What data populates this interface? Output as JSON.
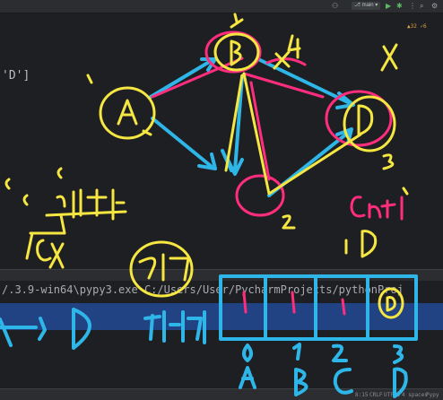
{
  "toolbar": {
    "user_icon": "user-icon",
    "branch": "main",
    "run_icon": "run-icon",
    "debug_icon": "debug-icon",
    "more_icon": "more-icon",
    "search_icon": "search-icon",
    "settings_icon": "gear-icon"
  },
  "editor": {
    "code_fragment": "'D']",
    "inspection_counts": "▲32  ✓6"
  },
  "terminal": {
    "command": "/.3.9-win64\\pypy3.exe C:/Users/User/PycharmProjects/pythonProj",
    "output": "1D"
  },
  "statusbar": {
    "position": "8:15",
    "line_sep": "CRLF",
    "encoding": "UTF-8",
    "indent": "4 spaces",
    "interpreter": "Pypy 3.9"
  },
  "annotations": {
    "nodes": [
      "A",
      "B",
      "C",
      "D"
    ],
    "edge_weights": [
      "1",
      "2",
      "3"
    ],
    "count_label": "cnt 1",
    "count_value": "1 D",
    "topo_label": "위상정렬",
    "path_label": "경로",
    "path_question": "A → D",
    "how_many": "몇가지",
    "array_indices": [
      "0",
      "1",
      "2",
      "3"
    ],
    "array_labels": [
      "A",
      "B",
      "C",
      "D"
    ],
    "array_marks": [
      "1",
      "1",
      "1",
      "1"
    ],
    "letters": [
      "c",
      "c",
      "c",
      "10"
    ],
    "crossed_mark": "x4",
    "x_mark": "X"
  },
  "colors": {
    "editor_bg": "#1e1f22",
    "panel_bg": "#2b2d30",
    "selection": "#214283",
    "ink_blue": "#2fb6e8",
    "ink_yellow": "#f5e642",
    "ink_pink": "#ff2d7e"
  }
}
